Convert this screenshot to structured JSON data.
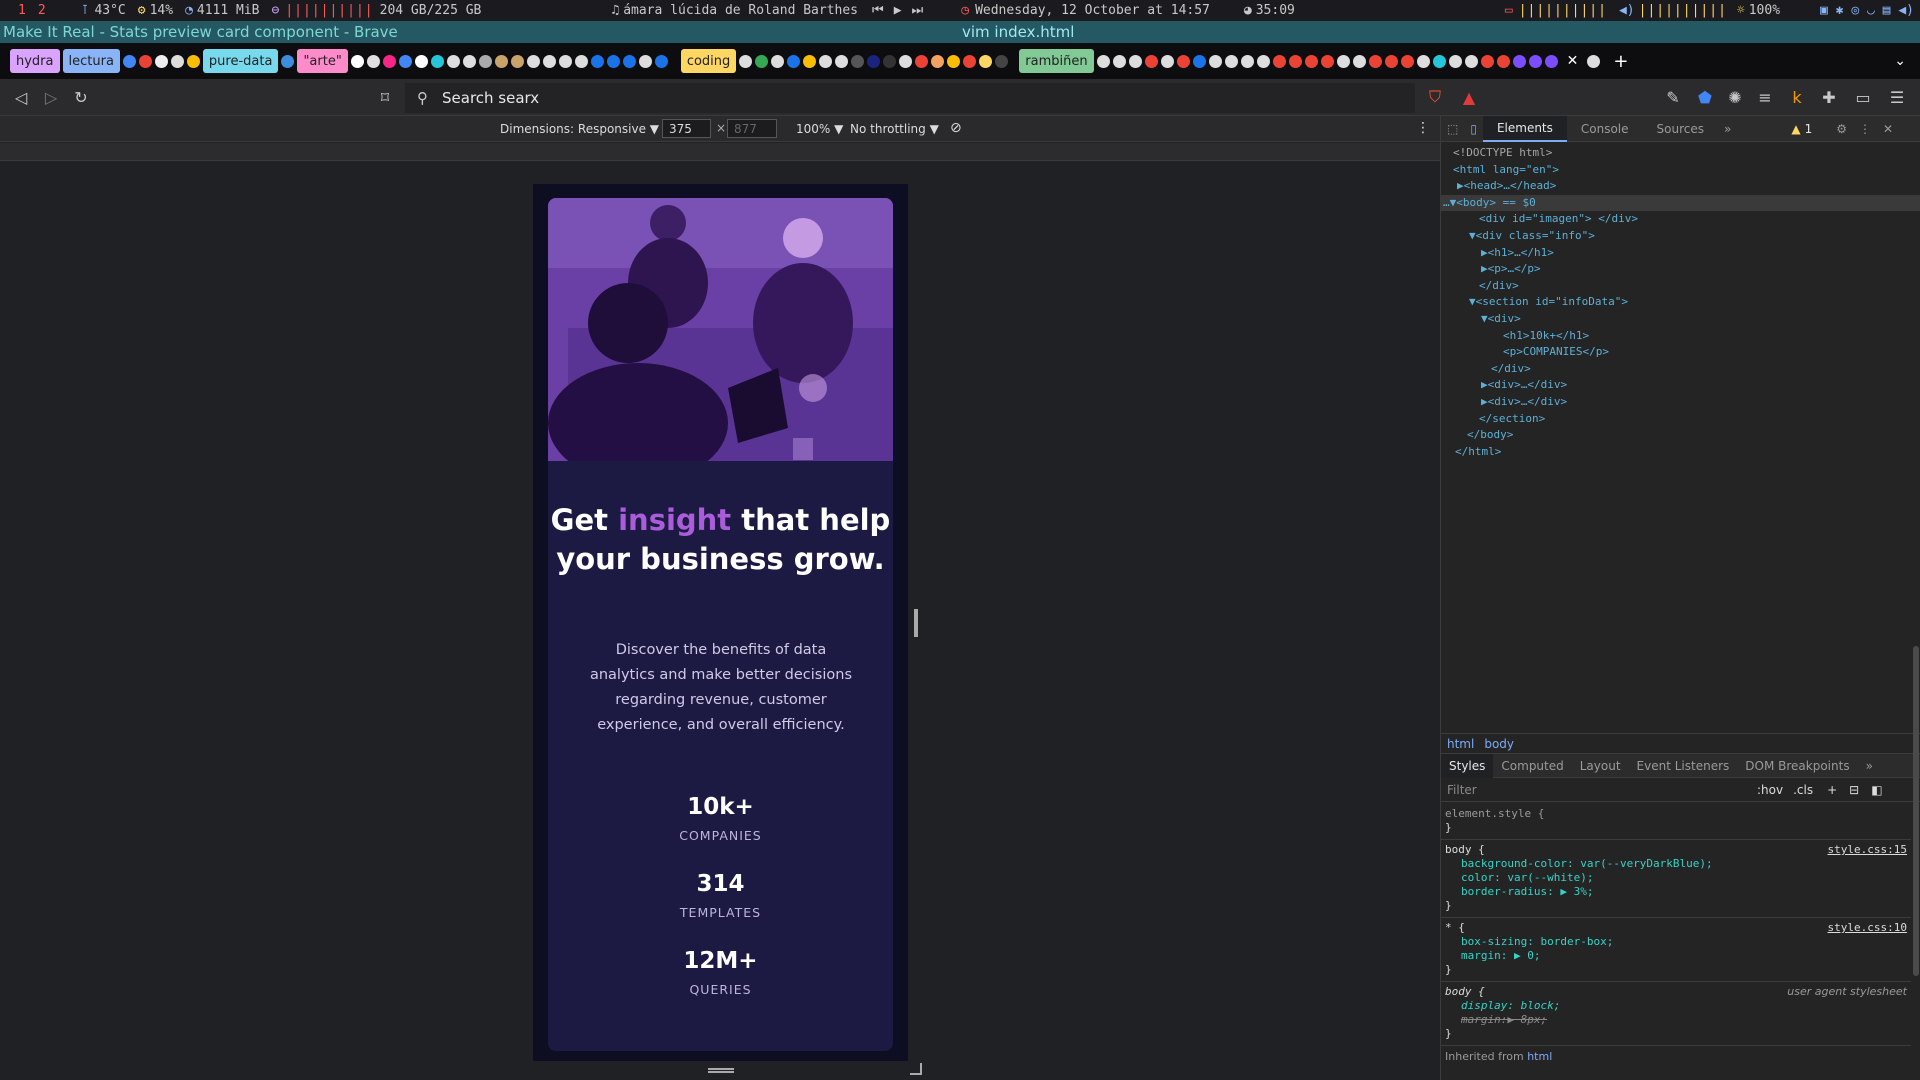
{
  "statusbar": {
    "workspaces": [
      "1",
      "2"
    ],
    "temp": "43°C",
    "cpu": "14%",
    "mem": "4111 MiB",
    "disk_bar": "||||||||||",
    "disk": "204 GB/225 GB",
    "music": "ámara lúcida de Roland Barthes",
    "datetime": "Wednesday, 12 October at 14:57",
    "timer": "35:09",
    "battery_bar": "||||||||||",
    "volume_bar": "||||||||||",
    "brightness": "100%"
  },
  "titlebar": {
    "title": "Make It Real - Stats preview card component - Brave",
    "vim": "vim index.html"
  },
  "tabstrip": {
    "groups": [
      {
        "label": "hydra",
        "color": "#d9a3ff"
      },
      {
        "label": "lectura",
        "color": "#8ab4f8"
      },
      {
        "label": "pure-data",
        "color": "#78d9ec"
      },
      {
        "label": "\"arte\"",
        "color": "#ff8bcb"
      },
      {
        "label": "coding",
        "color": "#fdd663"
      },
      {
        "label": "rambiñen",
        "color": "#81c995"
      }
    ]
  },
  "navbar": {
    "search_placeholder": "Search searx"
  },
  "emulation": {
    "dimensions_label": "Dimensions: Responsive ▼",
    "width": "375",
    "height": "877",
    "zoom": "100% ▼",
    "throttling": "No throttling ▼"
  },
  "card": {
    "headline_pre": "Get ",
    "headline_highlight": "insight",
    "headline_post": " that help your business grow.",
    "description": "Discover the benefits of data analytics and make better decisions regarding revenue, customer experience, and overall efficiency.",
    "stats": [
      {
        "number": "10k+",
        "label": "COMPANIES"
      },
      {
        "number": "314",
        "label": "TEMPLATES"
      },
      {
        "number": "12M+",
        "label": "QUERIES"
      }
    ]
  },
  "devtools": {
    "tabs": [
      "Elements",
      "Console",
      "Sources"
    ],
    "warning_count": "1",
    "dom_lines": [
      "<!DOCTYPE html>",
      "<html lang=\"en\">",
      "▶<head>…</head>",
      "…▼<body> == $0",
      "<div id=\"imagen\"> </div>",
      "▼<div class=\"info\">",
      "▶<h1>…</h1>",
      "▶<p>…</p>",
      "</div>",
      "▼<section id=\"infoData\">",
      "▼<div>",
      "<h1>10k+</h1>",
      "<p>COMPANIES</p>",
      "</div>",
      "▶<div>…</div>",
      "▶<div>…</div>",
      "</section>",
      "</body>",
      "</html>"
    ],
    "breadcrumbs": [
      "html",
      "body"
    ],
    "style_tabs": [
      "Styles",
      "Computed",
      "Layout",
      "Event Listeners",
      "DOM Breakpoints"
    ],
    "filter_placeholder": "Filter",
    "filter_hov": ":hov",
    "filter_cls": ".cls",
    "rules": {
      "element_style": "element.style {",
      "body_selector": "body {",
      "body_src": "style.css:15",
      "body_props": [
        "background-color: var(--veryDarkBlue);",
        "color: var(--white);",
        "border-radius: ▶ 3%;"
      ],
      "star_selector": "* {",
      "star_src": "style.css:10",
      "star_props": [
        "box-sizing: border-box;",
        "margin: ▶ 0;"
      ],
      "ua_selector": "body {",
      "ua_src": "user agent stylesheet",
      "ua_props": [
        "display: block;",
        "margin:▶ 8px;"
      ],
      "inherited": "Inherited from ",
      "inherited_link": "html",
      "close_brace": "}"
    }
  },
  "colors": {
    "accent": "#aa5cdb",
    "card_bg": "#1c1a43",
    "page_bg": "#0d0e22"
  }
}
